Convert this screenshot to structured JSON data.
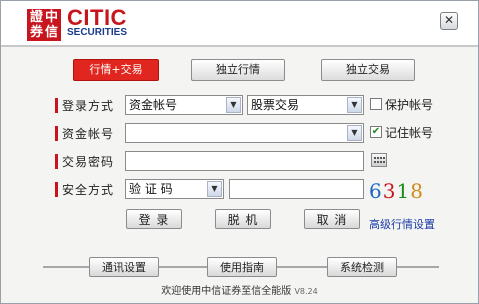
{
  "logo": {
    "seal_chars": [
      "證",
      "中",
      "券",
      "信"
    ],
    "brand": "CITIC",
    "brand_sub": "SECURITIES"
  },
  "window": {
    "close_glyph": "✕"
  },
  "tabs": [
    {
      "label": "行情+交易",
      "active": true
    },
    {
      "label": "独立行情",
      "active": false
    },
    {
      "label": "独立交易",
      "active": false
    }
  ],
  "form": {
    "login_method": {
      "label": "登录方式",
      "account_type": "资金帐号",
      "trade_type": "股票交易",
      "protect_label": "保护帐号",
      "protect_checked": false
    },
    "account": {
      "label": "资金帐号",
      "value": "",
      "remember_label": "记住帐号",
      "remember_checked": true
    },
    "password": {
      "label": "交易密码",
      "value": ""
    },
    "security": {
      "label": "安全方式",
      "method": "验 证 码",
      "code_value": "",
      "captcha": [
        "6",
        "3",
        "1",
        "8"
      ],
      "captcha_colors": [
        "#1a66c8",
        "#c8141c",
        "#1a8a1a",
        "#d08a1a"
      ]
    }
  },
  "actions": {
    "login": "登 录",
    "offline": "脱 机",
    "cancel": "取 消",
    "advanced_link": "高级行情设置"
  },
  "footer": {
    "buttons": [
      "通讯设置",
      "使用指南",
      "系统检测"
    ],
    "status": "欢迎使用中信证券至信全能版",
    "version": "V8.24"
  }
}
